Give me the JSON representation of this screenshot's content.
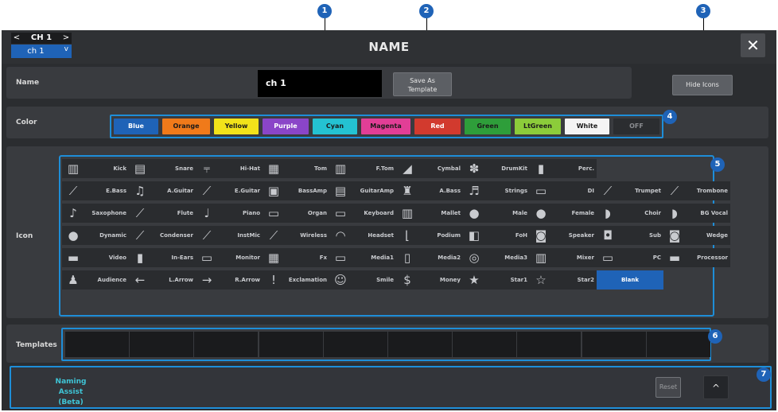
{
  "window": {
    "title": "NAME",
    "close_glyph": "✕"
  },
  "channel": {
    "name": "CH 1",
    "value": "ch 1",
    "prev_glyph": "<",
    "next_glyph": ">",
    "dropdown_glyph": "v"
  },
  "name_row": {
    "label": "Name",
    "value": "ch 1",
    "save_template_line1": "Save As",
    "save_template_line2": "Template",
    "hide_icons": "Hide Icons"
  },
  "color_row": {
    "label": "Color",
    "swatches": [
      {
        "label": "Blue",
        "bg": "#1f63b7",
        "fg": "#ffffff"
      },
      {
        "label": "Orange",
        "bg": "#f07a1a",
        "fg": "#1a1a1a"
      },
      {
        "label": "Yellow",
        "bg": "#f2e21a",
        "fg": "#1a1a1a"
      },
      {
        "label": "Purple",
        "bg": "#8a45c8",
        "fg": "#ffffff"
      },
      {
        "label": "Cyan",
        "bg": "#24c2d2",
        "fg": "#1a1a1a"
      },
      {
        "label": "Magenta",
        "bg": "#e23e96",
        "fg": "#1a1a1a"
      },
      {
        "label": "Red",
        "bg": "#d23a2e",
        "fg": "#ffffff"
      },
      {
        "label": "Green",
        "bg": "#2e9e3a",
        "fg": "#1a1a1a"
      },
      {
        "label": "LtGreen",
        "bg": "#8ccc3a",
        "fg": "#1a1a1a"
      },
      {
        "label": "White",
        "bg": "#f4f4f4",
        "fg": "#1a1a1a"
      },
      {
        "label": "OFF",
        "bg": "#2b2d30",
        "fg": "#8a8c90"
      }
    ]
  },
  "icon_row": {
    "label": "Icon",
    "icons": [
      {
        "label": "Kick",
        "icon": "kick-drum-icon",
        "glyph": "▥"
      },
      {
        "label": "Snare",
        "icon": "snare-drum-icon",
        "glyph": "▤"
      },
      {
        "label": "Hi-Hat",
        "icon": "hihat-icon",
        "glyph": "⫧"
      },
      {
        "label": "Tom",
        "icon": "tom-drum-icon",
        "glyph": "▦"
      },
      {
        "label": "F.Tom",
        "icon": "floor-tom-icon",
        "glyph": "▥"
      },
      {
        "label": "Cymbal",
        "icon": "cymbal-icon",
        "glyph": "◢"
      },
      {
        "label": "DrumKit",
        "icon": "drumkit-icon",
        "glyph": "✽"
      },
      {
        "label": "Perc.",
        "icon": "percussion-icon",
        "glyph": "▮"
      },
      {
        "label": "E.Bass",
        "icon": "electric-bass-icon",
        "glyph": "⟋"
      },
      {
        "label": "A.Guitar",
        "icon": "acoustic-guitar-icon",
        "glyph": "♫"
      },
      {
        "label": "E.Guitar",
        "icon": "electric-guitar-icon",
        "glyph": "⟋"
      },
      {
        "label": "BassAmp",
        "icon": "bass-amp-icon",
        "glyph": "▣"
      },
      {
        "label": "GuitarAmp",
        "icon": "guitar-amp-icon",
        "glyph": "▤"
      },
      {
        "label": "A.Bass",
        "icon": "acoustic-bass-icon",
        "glyph": "♜"
      },
      {
        "label": "Strings",
        "icon": "strings-icon",
        "glyph": "♬"
      },
      {
        "label": "DI",
        "icon": "di-box-icon",
        "glyph": "▭"
      },
      {
        "label": "Trumpet",
        "icon": "trumpet-icon",
        "glyph": "⟋"
      },
      {
        "label": "Trombone",
        "icon": "trombone-icon",
        "glyph": "⟋"
      },
      {
        "label": "Saxophone",
        "icon": "saxophone-icon",
        "glyph": "♪"
      },
      {
        "label": "Flute",
        "icon": "flute-icon",
        "glyph": "⟋"
      },
      {
        "label": "Piano",
        "icon": "piano-icon",
        "glyph": "♩"
      },
      {
        "label": "Organ",
        "icon": "organ-icon",
        "glyph": "▭"
      },
      {
        "label": "Keyboard",
        "icon": "keyboard-icon",
        "glyph": "▭"
      },
      {
        "label": "Mallet",
        "icon": "mallet-icon",
        "glyph": "▥"
      },
      {
        "label": "Male",
        "icon": "male-voice-icon",
        "glyph": "●"
      },
      {
        "label": "Female",
        "icon": "female-voice-icon",
        "glyph": "●"
      },
      {
        "label": "Choir",
        "icon": "choir-icon",
        "glyph": "◗"
      },
      {
        "label": "BG Vocal",
        "icon": "bg-vocal-icon",
        "glyph": "◗"
      },
      {
        "label": "Dynamic",
        "icon": "dynamic-mic-icon",
        "glyph": "●"
      },
      {
        "label": "Condenser",
        "icon": "condenser-mic-icon",
        "glyph": "⟋"
      },
      {
        "label": "InstMic",
        "icon": "instrument-mic-icon",
        "glyph": "⟋"
      },
      {
        "label": "Wireless",
        "icon": "wireless-mic-icon",
        "glyph": "⟋"
      },
      {
        "label": "Headset",
        "icon": "headset-icon",
        "glyph": "◠"
      },
      {
        "label": "Podium",
        "icon": "podium-icon",
        "glyph": "⌊"
      },
      {
        "label": "FoH",
        "icon": "foh-speaker-icon",
        "glyph": "◧"
      },
      {
        "label": "Speaker",
        "icon": "speaker-icon",
        "glyph": "◙"
      },
      {
        "label": "Sub",
        "icon": "subwoofer-icon",
        "glyph": "◘"
      },
      {
        "label": "Wedge",
        "icon": "wedge-monitor-icon",
        "glyph": "◙"
      },
      {
        "label": "Video",
        "icon": "video-camera-icon",
        "glyph": "▬"
      },
      {
        "label": "In-Ears",
        "icon": "in-ears-icon",
        "glyph": "▮"
      },
      {
        "label": "Monitor",
        "icon": "monitor-icon",
        "glyph": "▭"
      },
      {
        "label": "Fx",
        "icon": "fx-icon",
        "glyph": "▦"
      },
      {
        "label": "Media1",
        "icon": "media1-icon",
        "glyph": "▭"
      },
      {
        "label": "Media2",
        "icon": "media2-icon",
        "glyph": "▯"
      },
      {
        "label": "Media3",
        "icon": "media3-icon",
        "glyph": "◎"
      },
      {
        "label": "Mixer",
        "icon": "mixer-icon",
        "glyph": "▥"
      },
      {
        "label": "PC",
        "icon": "laptop-icon",
        "glyph": "▭"
      },
      {
        "label": "Processor",
        "icon": "processor-icon",
        "glyph": "▬"
      },
      {
        "label": "Audience",
        "icon": "audience-icon",
        "glyph": "♟"
      },
      {
        "label": "L.Arrow",
        "icon": "left-arrow-icon",
        "glyph": "←"
      },
      {
        "label": "R.Arrow",
        "icon": "right-arrow-icon",
        "glyph": "→"
      },
      {
        "label": "Exclamation",
        "icon": "exclamation-icon",
        "glyph": "!"
      },
      {
        "label": "Smile",
        "icon": "smile-icon",
        "glyph": "☺"
      },
      {
        "label": "Money",
        "icon": "money-icon",
        "glyph": "$"
      },
      {
        "label": "Star1",
        "icon": "star-filled-icon",
        "glyph": "★"
      },
      {
        "label": "Star2",
        "icon": "star-outline-icon",
        "glyph": "☆"
      },
      {
        "label": "Blank",
        "icon": "",
        "glyph": "",
        "selected": true
      }
    ]
  },
  "templates_row": {
    "label": "Templates"
  },
  "assist_row": {
    "label_line1": "Naming Assist",
    "label_line2": "(Beta)",
    "reset": "Reset",
    "expand_glyph": "^"
  },
  "callouts": [
    "1",
    "2",
    "3",
    "4",
    "5",
    "6",
    "7"
  ]
}
